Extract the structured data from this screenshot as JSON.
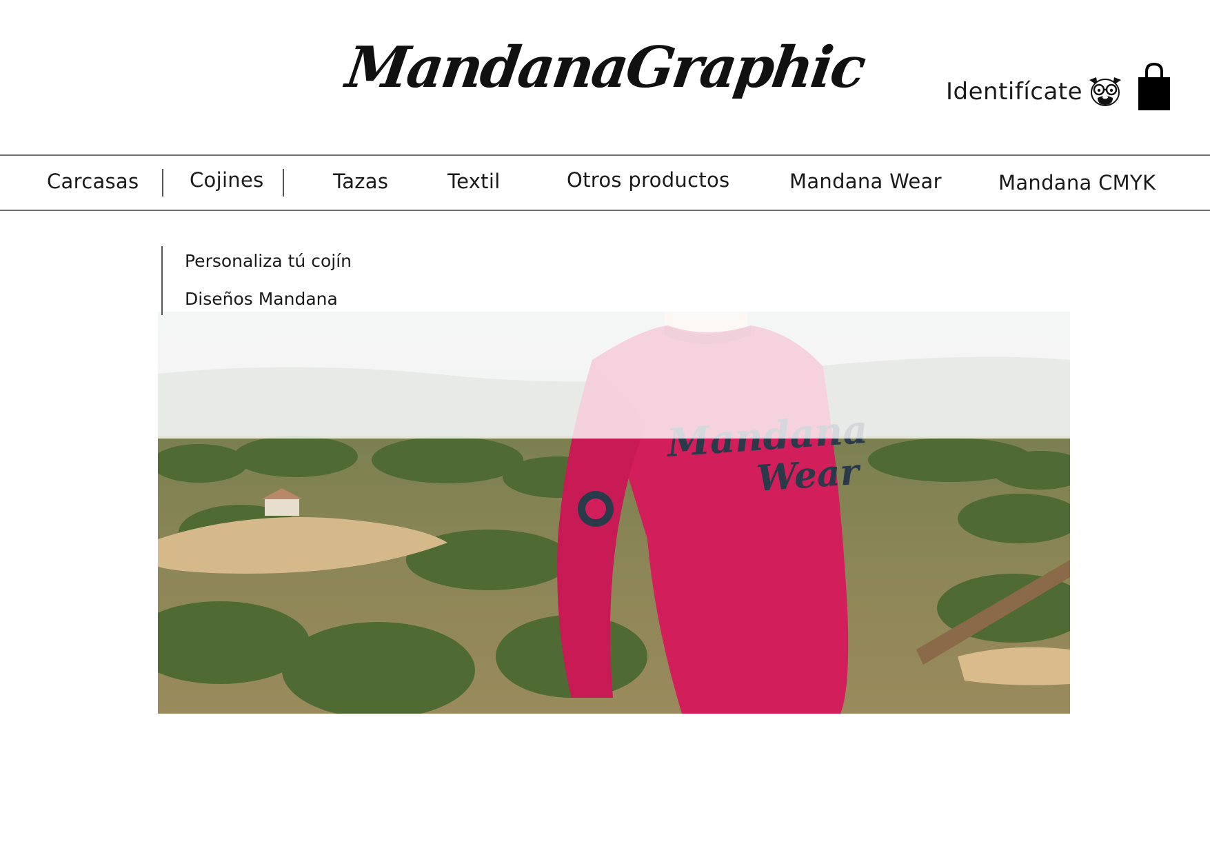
{
  "header": {
    "logo_text": "MandanaGraphic",
    "login_label": "Identifícate",
    "login_icon": "pug-glasses-icon",
    "cart_icon": "shopping-bag-icon"
  },
  "nav": {
    "items": [
      {
        "label": "Carcasas"
      },
      {
        "label": "Cojines"
      },
      {
        "label": "Tazas"
      },
      {
        "label": "Textil"
      },
      {
        "label": "Otros productos"
      },
      {
        "label": "Mandana Wear"
      },
      {
        "label": "Mandana CMYK"
      }
    ]
  },
  "dropdown": {
    "parent": "Cojines",
    "items": [
      {
        "label": "Personaliza tú cojín"
      },
      {
        "label": "Diseños Mandana"
      }
    ]
  },
  "hero": {
    "sweatshirt_text": "Mandana Wear",
    "colors": {
      "sweatshirt": "#d21f5c",
      "print": "#2b3a4a"
    }
  }
}
